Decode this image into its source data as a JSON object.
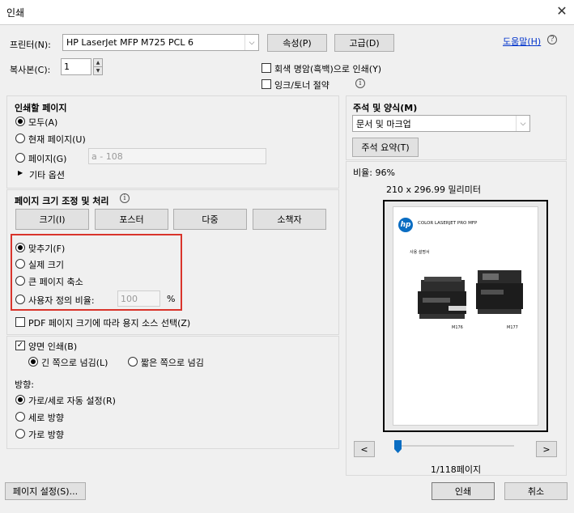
{
  "window": {
    "title": "인쇄"
  },
  "printer": {
    "label": "프린터(N):",
    "selected": "HP LaserJet MFP M725 PCL 6",
    "properties_btn": "속성(P)",
    "advanced_btn": "고급(D)",
    "help_link": "도움말(H)"
  },
  "copies": {
    "label": "복사본(C):",
    "value": "1"
  },
  "options": {
    "grayscale": "회색 명암(흑백)으로 인쇄(Y)",
    "ink_save": "잉크/토너 절약"
  },
  "pages_to_print": {
    "title": "인쇄할 페이지",
    "all": "모두(A)",
    "current": "현재 페이지(U)",
    "pages": "페이지(G)",
    "pages_placeholder": "a - 108",
    "more_options": "기타 옵션"
  },
  "annotations": {
    "title": "주석 및 양식(M)",
    "selected": "문서 및 마크업",
    "summary_btn": "주석 요약(T)"
  },
  "page_sizing": {
    "title": "페이지 크기 조정 및 처리",
    "tabs": [
      "크기(I)",
      "포스터",
      "다중",
      "소책자"
    ],
    "fit": "맞추기(F)",
    "actual": "실제 크기",
    "shrink": "큰 페이지 축소",
    "custom": "사용자 정의 비율:",
    "custom_value": "100",
    "percent": "%",
    "pdf_source": "PDF 페이지 크기에 따라 용지 소스 선택(Z)"
  },
  "duplex": {
    "label": "양면 인쇄(B)",
    "long_edge": "긴 쪽으로 넘김(L)",
    "short_edge": "짧은 쪽으로 넘김"
  },
  "orientation": {
    "title": "방향:",
    "auto": "가로/세로 자동 설정(R)",
    "portrait": "세로 방향",
    "landscape": "가로 방향"
  },
  "preview": {
    "scale": "비율: 96%",
    "dimensions": "210 x 296.99 밀리미터",
    "page_logo": "hp",
    "page_header": "COLOR LASERJET PRO MFP",
    "page_subtitle": "사용 설명서",
    "model_left": "M176",
    "model_right": "M177",
    "prev": "<",
    "next": ">",
    "page_indicator": "1/118페이지",
    "slider_position": 0.0
  },
  "footer": {
    "page_setup_btn": "페이지 설정(S)...",
    "print_btn": "인쇄",
    "cancel_btn": "취소"
  }
}
